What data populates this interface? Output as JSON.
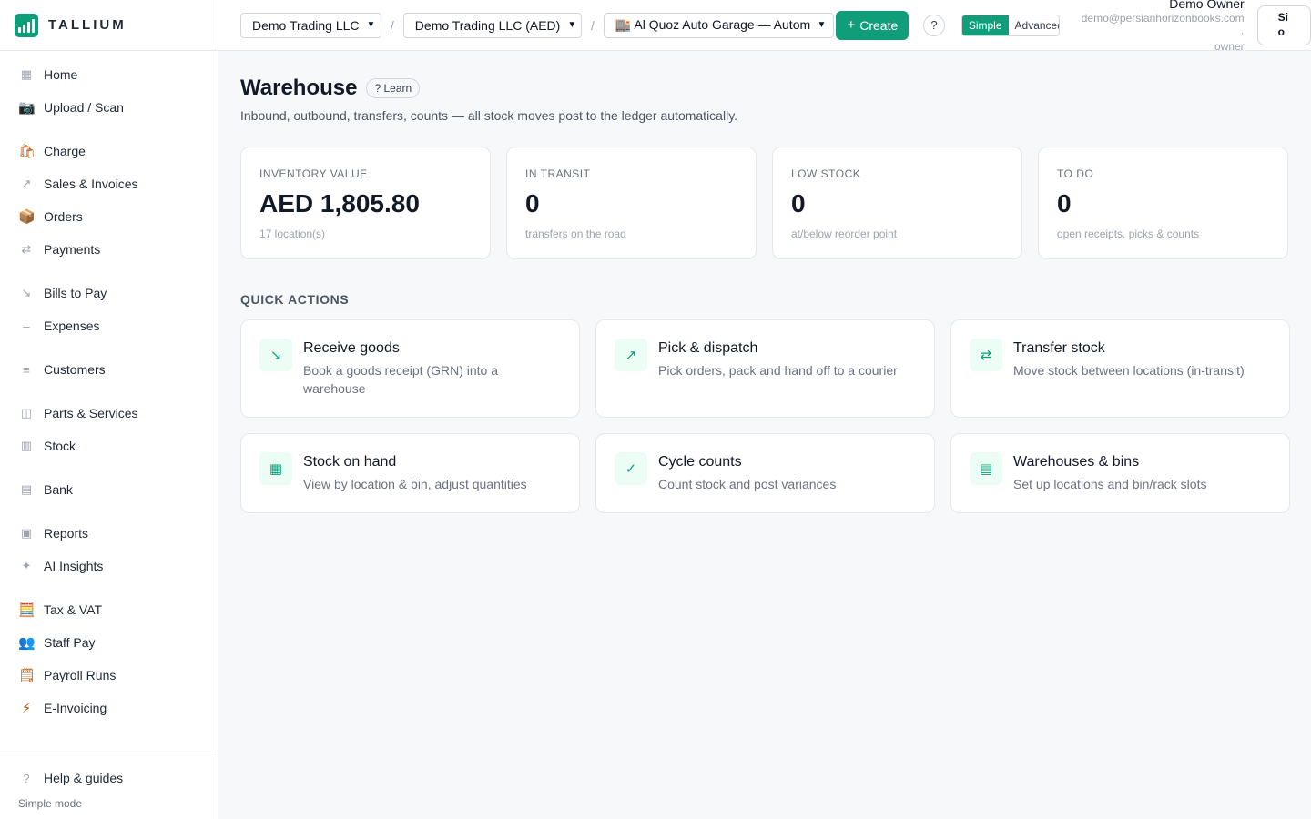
{
  "brand": {
    "name": "TALLIUM"
  },
  "sidebar": {
    "groups": [
      [
        {
          "icon": "▦",
          "label": "Home"
        },
        {
          "icon": "📷",
          "label": "Upload / Scan"
        }
      ],
      [
        {
          "icon": "🛍",
          "label": "Charge"
        },
        {
          "icon": "↗",
          "label": "Sales & Invoices"
        },
        {
          "icon": "📦",
          "label": "Orders"
        },
        {
          "icon": "⇄",
          "label": "Payments"
        }
      ],
      [
        {
          "icon": "↘",
          "label": "Bills to Pay"
        },
        {
          "icon": "–",
          "label": "Expenses"
        }
      ],
      [
        {
          "icon": "≡",
          "label": "Customers"
        }
      ],
      [
        {
          "icon": "◫",
          "label": "Parts & Services"
        },
        {
          "icon": "▥",
          "label": "Stock"
        }
      ],
      [
        {
          "icon": "▤",
          "label": "Bank"
        }
      ],
      [
        {
          "icon": "▣",
          "label": "Reports"
        },
        {
          "icon": "✦",
          "label": "AI Insights"
        }
      ],
      [
        {
          "icon": "🧮",
          "label": "Tax & VAT"
        },
        {
          "icon": "👥",
          "label": "Staff Pay"
        },
        {
          "icon": "🗒",
          "label": "Payroll Runs"
        },
        {
          "icon": "⚡",
          "label": "E-Invoicing"
        }
      ]
    ],
    "help": {
      "icon": "?",
      "label": "Help & guides"
    },
    "mode_label": "Simple mode"
  },
  "topbar": {
    "company": "Demo Trading LLC",
    "ledger": "Demo Trading LLC (AED)",
    "location": "🏬 Al Quoz Auto Garage — Automotive",
    "create_label": "Create",
    "help": "?",
    "mode_simple": "Simple",
    "mode_advanced": "Advanced",
    "user_name": "Demo Owner",
    "user_email": "demo@persianhorizonbooks.com ·",
    "user_role": "owner",
    "signout_line1": "Si",
    "signout_line2": "o"
  },
  "page": {
    "title": "Warehouse",
    "learn": "? Learn",
    "subtitle": "Inbound, outbound, transfers, counts — all stock moves post to the ledger automatically."
  },
  "kpis": [
    {
      "label": "INVENTORY VALUE",
      "value": "AED 1,805.80",
      "sub": "17 location(s)"
    },
    {
      "label": "IN TRANSIT",
      "value": "0",
      "sub": "transfers on the road"
    },
    {
      "label": "LOW STOCK",
      "value": "0",
      "sub": "at/below reorder point"
    },
    {
      "label": "TO DO",
      "value": "0",
      "sub": "open receipts, picks & counts"
    }
  ],
  "quick_actions_title": "QUICK ACTIONS",
  "actions": [
    {
      "icon": "↘",
      "title": "Receive goods",
      "desc": "Book a goods receipt (GRN) into a warehouse"
    },
    {
      "icon": "↗",
      "title": "Pick & dispatch",
      "desc": "Pick orders, pack and hand off to a courier"
    },
    {
      "icon": "⇄",
      "title": "Transfer stock",
      "desc": "Move stock between locations (in-transit)"
    },
    {
      "icon": "▦",
      "title": "Stock on hand",
      "desc": "View by location & bin, adjust quantities"
    },
    {
      "icon": "✓",
      "title": "Cycle counts",
      "desc": "Count stock and post variances"
    },
    {
      "icon": "▤",
      "title": "Warehouses & bins",
      "desc": "Set up locations and bin/rack slots"
    }
  ],
  "colors": {
    "accent": "#0f9d7a",
    "accent_soft": "#ecfdf5",
    "background": "#f6f8fa"
  }
}
